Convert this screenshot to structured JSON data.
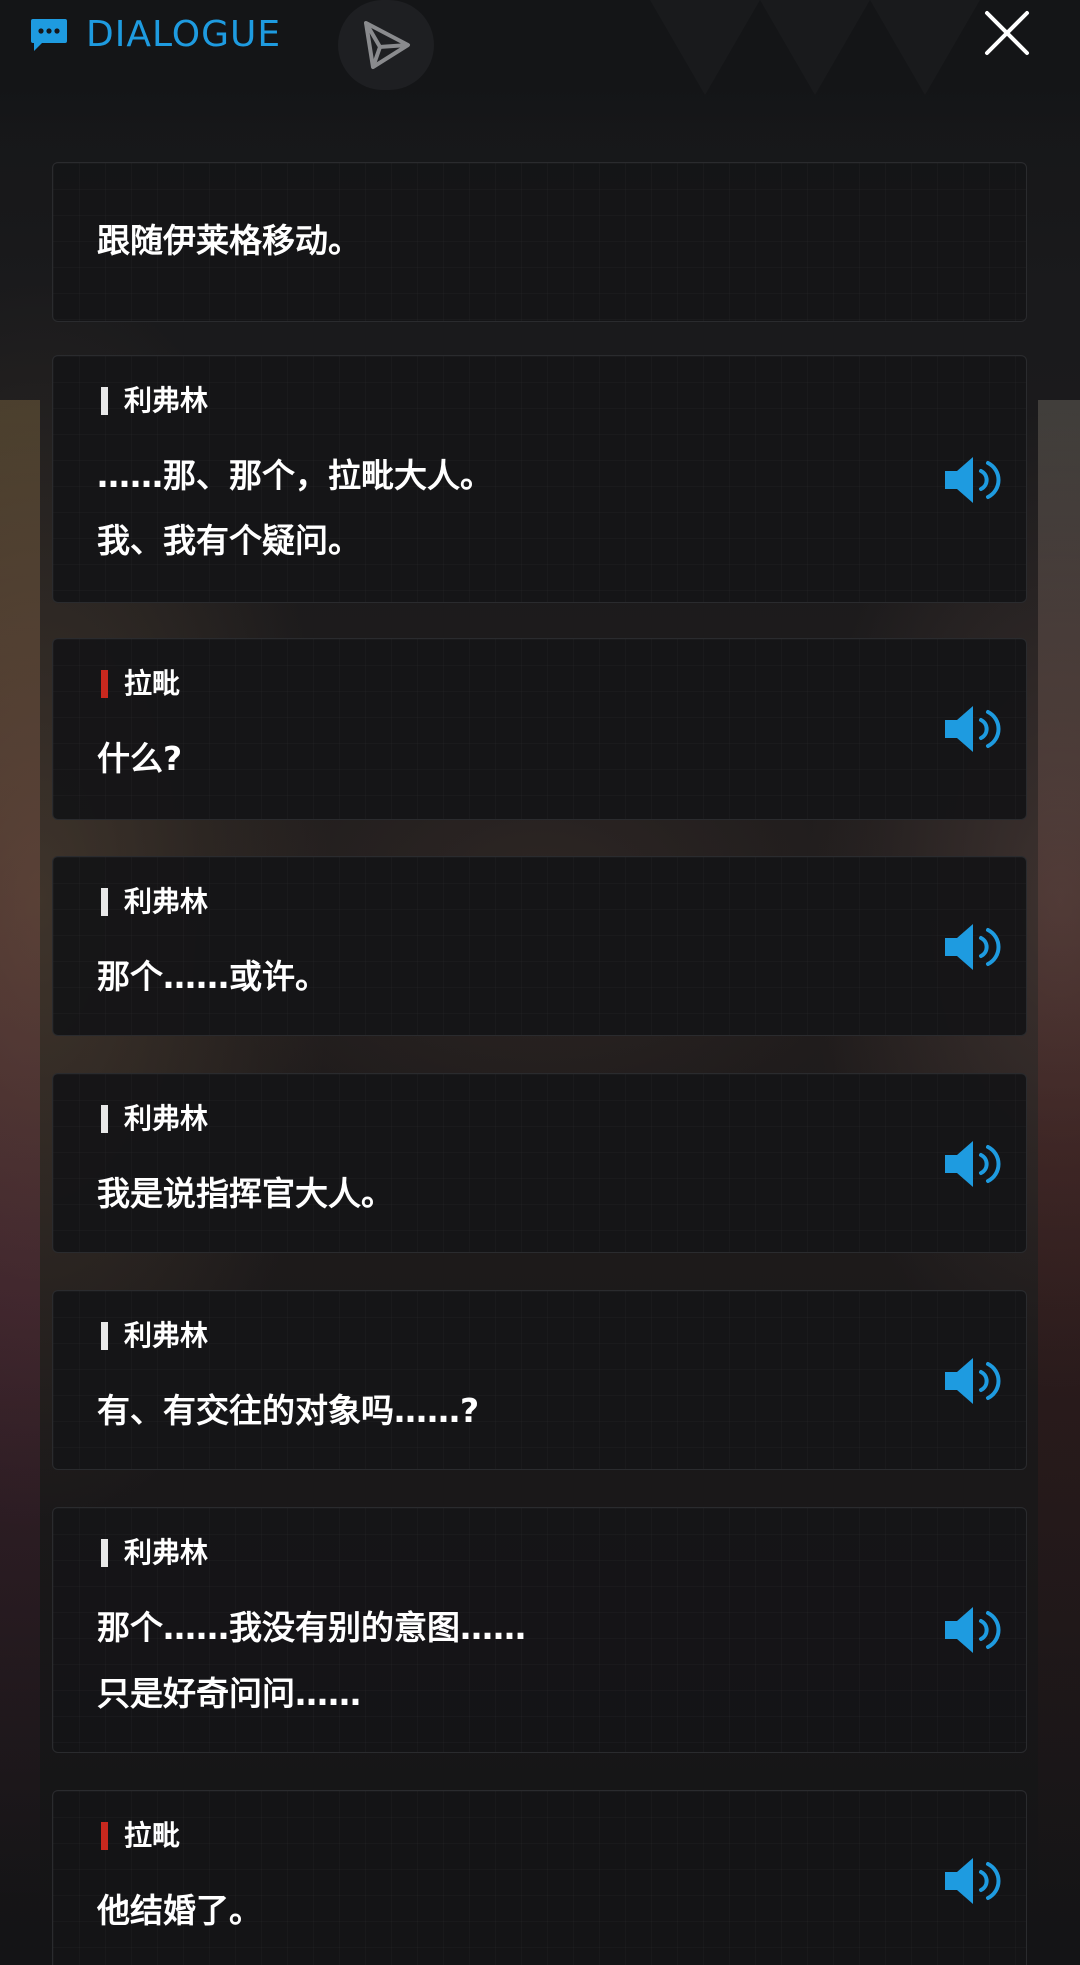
{
  "header": {
    "title": "DIALOGUE"
  },
  "colors": {
    "accent": "#1e9be0",
    "bar_default": "#e8e8e8",
    "bar_highlight": "#c8281e",
    "card_bg": "#151517"
  },
  "icons": {
    "title": "chat-bubble-icon",
    "send": "send-arrow-icon",
    "close": "close-icon",
    "voice": "speaker-volume-icon"
  },
  "entries": [
    {
      "type": "narration",
      "lines": [
        "跟随伊莱格移动。"
      ]
    },
    {
      "type": "dialogue",
      "speaker": "利弗林",
      "bar": "white",
      "lines": [
        "……那、那个，拉毗大人。",
        "我、我有个疑问。"
      ]
    },
    {
      "type": "dialogue",
      "speaker": "拉毗",
      "bar": "red",
      "lines": [
        "什么?"
      ]
    },
    {
      "type": "dialogue",
      "speaker": "利弗林",
      "bar": "white",
      "lines": [
        "那个……或许。"
      ]
    },
    {
      "type": "dialogue",
      "speaker": "利弗林",
      "bar": "white",
      "lines": [
        "我是说指挥官大人。"
      ]
    },
    {
      "type": "dialogue",
      "speaker": "利弗林",
      "bar": "white",
      "lines": [
        "有、有交往的对象吗……?"
      ]
    },
    {
      "type": "dialogue",
      "speaker": "利弗林",
      "bar": "white",
      "lines": [
        "那个……我没有别的意图……",
        "只是好奇问问……"
      ]
    },
    {
      "type": "dialogue",
      "speaker": "拉毗",
      "bar": "red",
      "lines": [
        "他结婚了。"
      ]
    }
  ]
}
